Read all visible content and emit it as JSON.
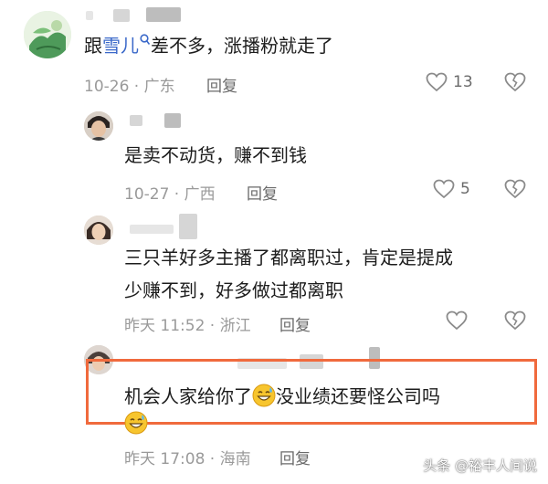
{
  "comments": [
    {
      "prefix": "跟",
      "mention": "雪儿",
      "body": "差不多，涨播粉就走了",
      "meta": "10-26 · 广东",
      "reply_label": "回复",
      "likes": "13"
    },
    {
      "body": "是卖不动货，赚不到钱",
      "meta": "10-27 · 广西",
      "reply_label": "回复",
      "likes": "5"
    },
    {
      "line1": "三只羊好多主播了都离职过，肯定是提成",
      "line2": "少赚不到，好多做过都离职",
      "meta": "昨天 11:52 · 浙江",
      "reply_label": "回复"
    },
    {
      "part1": "机会人家给你了",
      "part2": "没业绩还要怪公司吗",
      "meta": "昨天 17:08 · 海南",
      "reply_label": "回复"
    }
  ],
  "watermark": "头条 @裕丰人间说",
  "colors": {
    "mention": "#3a68c9",
    "highlight_border": "#f06a3d"
  }
}
